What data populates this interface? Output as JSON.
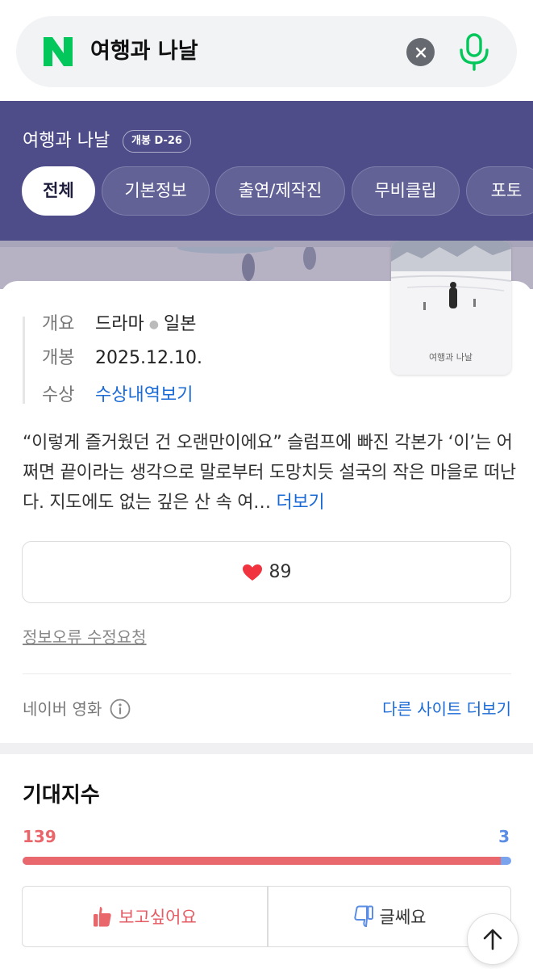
{
  "search": {
    "query": "여행과 나날",
    "logo_letter": "N"
  },
  "header": {
    "title": "여행과 나날",
    "badge": "개봉 D-26",
    "tabs": [
      {
        "label": "전체",
        "active": true
      },
      {
        "label": "기본정보",
        "active": false
      },
      {
        "label": "출연/제작진",
        "active": false
      },
      {
        "label": "무비클립",
        "active": false
      },
      {
        "label": "포토",
        "active": false
      }
    ]
  },
  "info": {
    "rows": [
      {
        "key": "개요",
        "value": "드라마",
        "value2": "일본"
      },
      {
        "key": "개봉",
        "value": "2025.12.10."
      },
      {
        "key": "수상",
        "value": "수상내역보기"
      }
    ],
    "poster_caption": "여행과 나날"
  },
  "synopsis": {
    "text": "“이렇게 즐거웠던 건 오랜만이에요” 슬럼프에 빠진 각본가 ‘이’는 어쩌면 끝이라는 생각으로 말로부터 도망치듯 설국의 작은 마을로 떠난다. 지도에도 없는 깊은 산 속 여…",
    "more": "더보기"
  },
  "like": {
    "count": "89"
  },
  "report": "정보오류 수정요청",
  "source": {
    "label": "네이버 영화",
    "other_sites": "다른 사이트 더보기"
  },
  "expectation": {
    "title": "기대지수",
    "want_count": "139",
    "meh_count": "3",
    "want_ratio": 0.979,
    "want_label": "보고싶어요",
    "meh_label": "글쎄요"
  },
  "colors": {
    "header_bg": "#4e4d89",
    "naver_green": "#03c75a",
    "link_blue": "#1a6ad6",
    "want_red": "#e9666b",
    "meh_blue": "#5b8de5"
  }
}
